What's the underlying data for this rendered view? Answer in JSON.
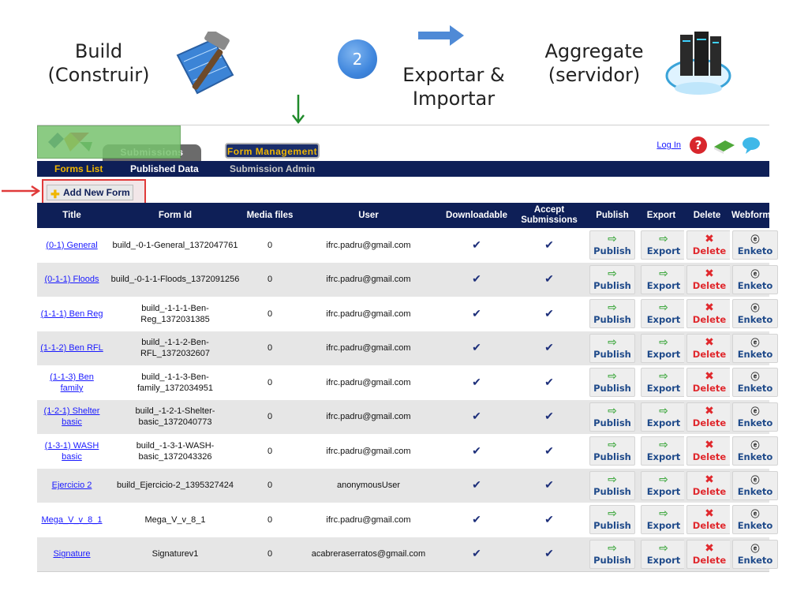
{
  "slide": {
    "build_label": "Build\n(Construir)",
    "step_number": "2",
    "export_label": "Exportar &\nImportar",
    "aggregate_label": "Aggregate\n(servidor)"
  },
  "icons": {
    "build": "hammer-blueprint-icon",
    "aggregate": "cloud-server-icon",
    "arrow": "arrow-right-icon"
  },
  "app": {
    "tabs": [
      "Submissions",
      "Form Management"
    ],
    "login": "Log In",
    "subnav": [
      "Forms List",
      "Published Data",
      "Submission Admin"
    ],
    "add_form": "Add New Form",
    "columns": [
      "Title",
      "Form Id",
      "Media files",
      "User",
      "Downloadable",
      "Accept Submissions",
      "Publish",
      "Export",
      "Delete",
      "Webform"
    ],
    "actions": {
      "publish": "Publish",
      "export": "Export",
      "delete": "Delete",
      "webform": "Enketo"
    },
    "check_glyph": "✔",
    "rows": [
      {
        "title": "(0-1) General",
        "form_id": "build_-0-1-General_1372047761",
        "media": "0",
        "user": "ifrc.padru@gmail.com"
      },
      {
        "title": "(0-1-1) Floods",
        "form_id": "build_-0-1-1-Floods_1372091256",
        "media": "0",
        "user": "ifrc.padru@gmail.com"
      },
      {
        "title": "(1-1-1) Ben Reg",
        "form_id": "build_-1-1-1-Ben-Reg_1372031385",
        "media": "0",
        "user": "ifrc.padru@gmail.com"
      },
      {
        "title": "(1-1-2) Ben RFL",
        "form_id": "build_-1-1-2-Ben-RFL_1372032607",
        "media": "0",
        "user": "ifrc.padru@gmail.com"
      },
      {
        "title": "(1-1-3) Ben family",
        "form_id": "build_-1-1-3-Ben-family_1372034951",
        "media": "0",
        "user": "ifrc.padru@gmail.com"
      },
      {
        "title": "(1-2-1) Shelter basic",
        "form_id": "build_-1-2-1-Shelter-basic_1372040773",
        "media": "0",
        "user": "ifrc.padru@gmail.com"
      },
      {
        "title": "(1-3-1) WASH basic",
        "form_id": "build_-1-3-1-WASH-basic_1372043326",
        "media": "0",
        "user": "ifrc.padru@gmail.com"
      },
      {
        "title": "Ejercicio 2",
        "form_id": "build_Ejercicio-2_1395327424",
        "media": "0",
        "user": "anonymousUser"
      },
      {
        "title": "Mega_V_v_8_1",
        "form_id": "Mega_V_v_8_1",
        "media": "0",
        "user": "ifrc.padru@gmail.com"
      },
      {
        "title": "Signature",
        "form_id": "Signaturev1",
        "media": "0",
        "user": "acabreraserratos@gmail.com"
      }
    ]
  },
  "colors": {
    "nav_bg": "#0e1f57",
    "active_tab_text": "#f0b600",
    "highlight_green": "#77c26e",
    "highlight_red": "#e03a3a",
    "step_blue": "#3f86dd"
  }
}
